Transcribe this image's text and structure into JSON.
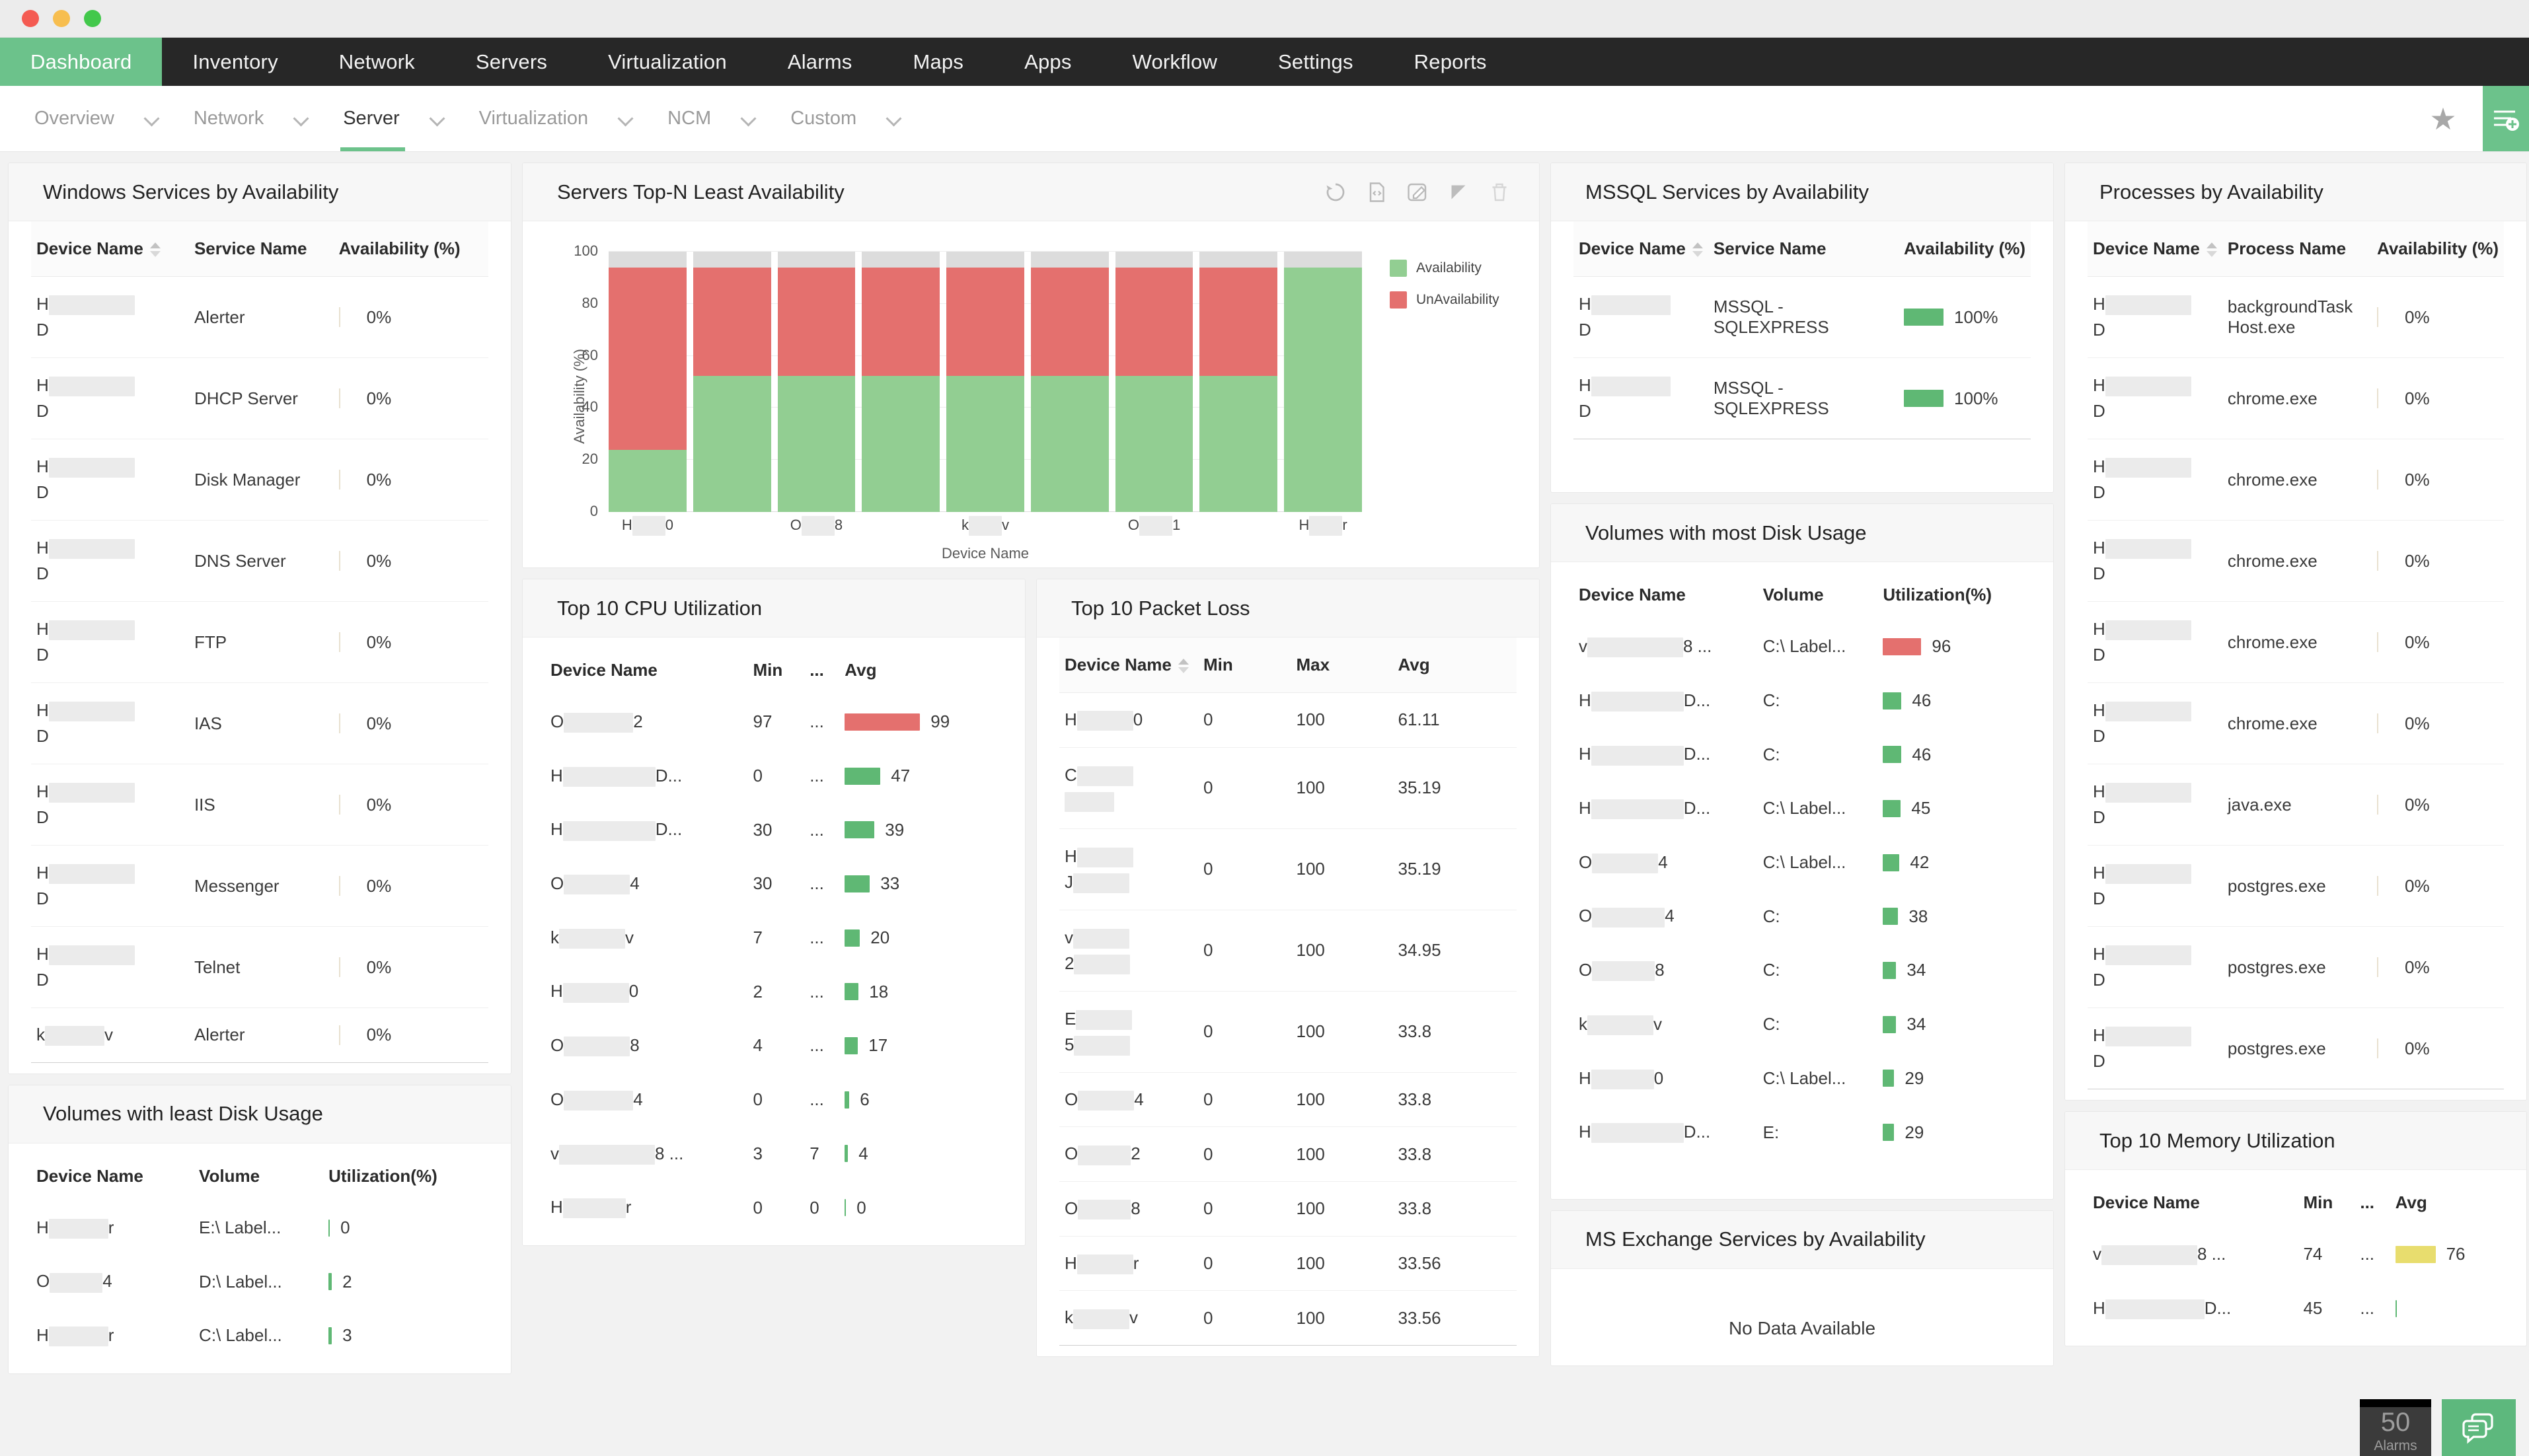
{
  "window": {
    "controls": [
      "close",
      "minimize",
      "maximize"
    ]
  },
  "main_nav": {
    "items": [
      {
        "label": "Dashboard",
        "active": true
      },
      {
        "label": "Inventory",
        "active": false
      },
      {
        "label": "Network",
        "active": false
      },
      {
        "label": "Servers",
        "active": false
      },
      {
        "label": "Virtualization",
        "active": false
      },
      {
        "label": "Alarms",
        "active": false
      },
      {
        "label": "Maps",
        "active": false
      },
      {
        "label": "Apps",
        "active": false
      },
      {
        "label": "Workflow",
        "active": false
      },
      {
        "label": "Settings",
        "active": false
      },
      {
        "label": "Reports",
        "active": false
      }
    ]
  },
  "sub_nav": {
    "items": [
      {
        "label": "Overview",
        "active": false
      },
      {
        "label": "Network",
        "active": false
      },
      {
        "label": "Server",
        "active": true
      },
      {
        "label": "Virtualization",
        "active": false
      },
      {
        "label": "NCM",
        "active": false
      },
      {
        "label": "Custom",
        "active": false
      }
    ],
    "favorite_icon": "star-icon",
    "add_widget_icon": "add-widget-icon"
  },
  "cards": {
    "windows_services": {
      "title": "Windows Services by Availability",
      "columns": [
        "Device Name",
        "Service Name",
        "Availability (%)"
      ],
      "rows": [
        {
          "device_prefix": "H",
          "device_suffix": "D",
          "redact_w": 130,
          "service": "Alerter",
          "availability": "0%"
        },
        {
          "device_prefix": "H",
          "device_suffix": "D",
          "redact_w": 130,
          "service": "DHCP Server",
          "availability": "0%"
        },
        {
          "device_prefix": "H",
          "device_suffix": "D",
          "redact_w": 130,
          "service": "Disk Manager",
          "availability": "0%"
        },
        {
          "device_prefix": "H",
          "device_suffix": "D",
          "redact_w": 130,
          "service": "DNS Server",
          "availability": "0%"
        },
        {
          "device_prefix": "H",
          "device_suffix": "D",
          "redact_w": 130,
          "service": "FTP",
          "availability": "0%"
        },
        {
          "device_prefix": "H",
          "device_suffix": "D",
          "redact_w": 130,
          "service": "IAS",
          "availability": "0%"
        },
        {
          "device_prefix": "H",
          "device_suffix": "D",
          "redact_w": 130,
          "service": "IIS",
          "availability": "0%"
        },
        {
          "device_prefix": "H",
          "device_suffix": "D",
          "redact_w": 130,
          "service": "Messenger",
          "availability": "0%"
        },
        {
          "device_prefix": "H",
          "device_suffix": "D",
          "redact_w": 130,
          "service": "Telnet",
          "availability": "0%"
        },
        {
          "device_prefix": "k",
          "device_suffix": "v",
          "redact_w": 90,
          "inline": true,
          "service": "Alerter",
          "availability": "0%"
        }
      ]
    },
    "volumes_least": {
      "title": "Volumes with least Disk Usage",
      "columns": [
        "Device Name",
        "Volume",
        "Utilization(%)"
      ],
      "rows": [
        {
          "device_prefix": "H",
          "device_suffix": "r",
          "redact_w": 90,
          "volume": "E:\\ Label...",
          "value": "0",
          "bar_pct": 0,
          "bar_color": "green"
        },
        {
          "device_prefix": "O",
          "device_suffix": "4",
          "redact_w": 80,
          "volume": "D:\\ Label...",
          "value": "2",
          "bar_pct": 2,
          "bar_color": "green"
        },
        {
          "device_prefix": "H",
          "device_suffix": "r",
          "redact_w": 90,
          "volume": "C:\\ Label...",
          "value": "3",
          "bar_pct": 3,
          "bar_color": "green"
        }
      ]
    },
    "servers_topn": {
      "title": "Servers Top-N Least Availability",
      "tools": [
        "refresh-icon",
        "export-code-icon",
        "edit-icon",
        "resize-icon",
        "delete-icon"
      ]
    },
    "cpu_util": {
      "title": "Top 10 CPU Utilization",
      "columns": [
        "Device Name",
        "Min",
        "...",
        "Avg"
      ],
      "rows": [
        {
          "device_prefix": "O",
          "device_suffix": "2",
          "redact_w": 105,
          "min": "97",
          "mid": "...",
          "avg": "99",
          "bar_pct": 99,
          "bar_color": "red"
        },
        {
          "device_prefix": "H",
          "device_suffix": "D...",
          "redact_w": 140,
          "min": "0",
          "mid": "...",
          "avg": "47",
          "bar_pct": 47,
          "bar_color": "green"
        },
        {
          "device_prefix": "H",
          "device_suffix": "D...",
          "redact_w": 140,
          "min": "30",
          "mid": "...",
          "avg": "39",
          "bar_pct": 39,
          "bar_color": "green"
        },
        {
          "device_prefix": "O",
          "device_suffix": "4",
          "redact_w": 100,
          "min": "30",
          "mid": "...",
          "avg": "33",
          "bar_pct": 33,
          "bar_color": "green"
        },
        {
          "device_prefix": "k",
          "device_suffix": "v",
          "redact_w": 100,
          "min": "7",
          "mid": "...",
          "avg": "20",
          "bar_pct": 20,
          "bar_color": "green"
        },
        {
          "device_prefix": "H",
          "device_suffix": "0",
          "redact_w": 100,
          "min": "2",
          "mid": "...",
          "avg": "18",
          "bar_pct": 18,
          "bar_color": "green"
        },
        {
          "device_prefix": "O",
          "device_suffix": "8",
          "redact_w": 100,
          "min": "4",
          "mid": "...",
          "avg": "17",
          "bar_pct": 17,
          "bar_color": "green"
        },
        {
          "device_prefix": "O",
          "device_suffix": "4",
          "redact_w": 105,
          "min": "0",
          "mid": "...",
          "avg": "6",
          "bar_pct": 6,
          "bar_color": "green"
        },
        {
          "device_prefix": "v",
          "device_suffix": "8 ...",
          "redact_w": 145,
          "min": "3",
          "mid": "7",
          "avg": "4",
          "bar_pct": 4,
          "bar_color": "green"
        },
        {
          "device_prefix": "H",
          "device_suffix": "r",
          "redact_w": 95,
          "min": "0",
          "mid": "0",
          "avg": "0",
          "bar_pct": 0,
          "bar_color": "green"
        }
      ]
    },
    "packet_loss": {
      "title": "Top 10 Packet Loss",
      "columns": [
        "Device Name",
        "Min",
        "Max",
        "Avg"
      ],
      "rows": [
        {
          "device_prefix": "H",
          "device_suffix": "0",
          "redact_w": 85,
          "inline": true,
          "min": "0",
          "max": "100",
          "avg": "61.11"
        },
        {
          "device_prefix": "C",
          "device_suffix": "",
          "redact_w": 85,
          "inline": false,
          "second_redact_w": 75,
          "min": "0",
          "max": "100",
          "avg": "35.19"
        },
        {
          "device_prefix": "H",
          "device_suffix": "J",
          "redact_w": 85,
          "inline": false,
          "second_redact_w": 85,
          "min": "0",
          "max": "100",
          "avg": "35.19"
        },
        {
          "device_prefix": "v",
          "device_suffix": "2",
          "redact_w": 85,
          "inline": false,
          "second_redact_w": 85,
          "min": "0",
          "max": "100",
          "avg": "34.95"
        },
        {
          "device_prefix": "E",
          "device_suffix": "5",
          "redact_w": 85,
          "inline": false,
          "second_redact_w": 85,
          "min": "0",
          "max": "100",
          "avg": "33.8"
        },
        {
          "device_prefix": "O",
          "device_suffix": "4",
          "redact_w": 85,
          "inline": true,
          "min": "0",
          "max": "100",
          "avg": "33.8"
        },
        {
          "device_prefix": "O",
          "device_suffix": "2",
          "redact_w": 80,
          "inline": true,
          "min": "0",
          "max": "100",
          "avg": "33.8"
        },
        {
          "device_prefix": "O",
          "device_suffix": "8",
          "redact_w": 80,
          "inline": true,
          "min": "0",
          "max": "100",
          "avg": "33.8"
        },
        {
          "device_prefix": "H",
          "device_suffix": "r",
          "redact_w": 85,
          "inline": true,
          "min": "0",
          "max": "100",
          "avg": "33.56"
        },
        {
          "device_prefix": "k",
          "device_suffix": "v",
          "redact_w": 85,
          "inline": true,
          "min": "0",
          "max": "100",
          "avg": "33.56"
        }
      ]
    },
    "mssql_services": {
      "title": "MSSQL Services by Availability",
      "columns": [
        "Device Name",
        "Service Name",
        "Availability (%)"
      ],
      "rows": [
        {
          "device_prefix": "H",
          "device_suffix": "D",
          "redact_w": 120,
          "service": "MSSQL - SQLEXPRESS",
          "value": "100%",
          "bar_pct": 100,
          "bar_color": "green"
        },
        {
          "device_prefix": "H",
          "device_suffix": "D",
          "redact_w": 120,
          "service": "MSSQL - SQLEXPRESS",
          "value": "100%",
          "bar_pct": 100,
          "bar_color": "green"
        }
      ]
    },
    "volumes_most": {
      "title": "Volumes with most Disk Usage",
      "columns": [
        "Device Name",
        "Volume",
        "Utilization(%)"
      ],
      "rows": [
        {
          "device_prefix": "v",
          "device_suffix": "8 ...",
          "redact_w": 145,
          "volume": "C:\\ Label...",
          "value": "96",
          "bar_pct": 96,
          "bar_color": "red"
        },
        {
          "device_prefix": "H",
          "device_suffix": "D...",
          "redact_w": 140,
          "volume": "C:",
          "value": "46",
          "bar_pct": 46,
          "bar_color": "green"
        },
        {
          "device_prefix": "H",
          "device_suffix": "D...",
          "redact_w": 140,
          "volume": "C:",
          "value": "46",
          "bar_pct": 46,
          "bar_color": "green"
        },
        {
          "device_prefix": "H",
          "device_suffix": "D...",
          "redact_w": 140,
          "volume": "C:\\ Label...",
          "value": "45",
          "bar_pct": 45,
          "bar_color": "green"
        },
        {
          "device_prefix": "O",
          "device_suffix": "4",
          "redact_w": 100,
          "volume": "C:\\ Label...",
          "value": "42",
          "bar_pct": 42,
          "bar_color": "green"
        },
        {
          "device_prefix": "O",
          "device_suffix": "4",
          "redact_w": 110,
          "volume": "C:",
          "value": "38",
          "bar_pct": 38,
          "bar_color": "green"
        },
        {
          "device_prefix": "O",
          "device_suffix": "8",
          "redact_w": 95,
          "volume": "C:",
          "value": "34",
          "bar_pct": 34,
          "bar_color": "green"
        },
        {
          "device_prefix": "k",
          "device_suffix": "v",
          "redact_w": 100,
          "volume": "C:",
          "value": "34",
          "bar_pct": 34,
          "bar_color": "green"
        },
        {
          "device_prefix": "H",
          "device_suffix": "0",
          "redact_w": 95,
          "volume": "C:\\ Label...",
          "value": "29",
          "bar_pct": 29,
          "bar_color": "green"
        },
        {
          "device_prefix": "H",
          "device_suffix": "D...",
          "redact_w": 140,
          "volume": "E:",
          "value": "29",
          "bar_pct": 29,
          "bar_color": "green"
        }
      ]
    },
    "ms_exchange": {
      "title": "MS Exchange Services by Availability",
      "empty_message": "No Data Available"
    },
    "processes": {
      "title": "Processes by Availability",
      "columns": [
        "Device Name",
        "Process Name",
        "Availability (%)"
      ],
      "rows": [
        {
          "device_prefix": "H",
          "device_suffix": "D",
          "redact_w": 130,
          "process": "backgroundTask Host.exe",
          "availability": "0%"
        },
        {
          "device_prefix": "H",
          "device_suffix": "D",
          "redact_w": 130,
          "process": "chrome.exe",
          "availability": "0%"
        },
        {
          "device_prefix": "H",
          "device_suffix": "D",
          "redact_w": 130,
          "process": "chrome.exe",
          "availability": "0%"
        },
        {
          "device_prefix": "H",
          "device_suffix": "D",
          "redact_w": 130,
          "process": "chrome.exe",
          "availability": "0%"
        },
        {
          "device_prefix": "H",
          "device_suffix": "D",
          "redact_w": 130,
          "process": "chrome.exe",
          "availability": "0%"
        },
        {
          "device_prefix": "H",
          "device_suffix": "D",
          "redact_w": 130,
          "process": "chrome.exe",
          "availability": "0%"
        },
        {
          "device_prefix": "H",
          "device_suffix": "D",
          "redact_w": 130,
          "process": "java.exe",
          "availability": "0%"
        },
        {
          "device_prefix": "H",
          "device_suffix": "D",
          "redact_w": 130,
          "process": "postgres.exe",
          "availability": "0%"
        },
        {
          "device_prefix": "H",
          "device_suffix": "D",
          "redact_w": 130,
          "process": "postgres.exe",
          "availability": "0%"
        },
        {
          "device_prefix": "H",
          "device_suffix": "D",
          "redact_w": 130,
          "process": "postgres.exe",
          "availability": "0%"
        }
      ]
    },
    "memory_util": {
      "title": "Top 10 Memory Utilization",
      "columns": [
        "Device Name",
        "Min",
        "...",
        "Avg"
      ],
      "rows": [
        {
          "device_prefix": "v",
          "device_suffix": "8 ...",
          "redact_w": 145,
          "min": "74",
          "mid": "...",
          "avg": "76",
          "bar_pct": 76,
          "bar_color": "yellow"
        },
        {
          "device_prefix": "H",
          "device_suffix": "D...",
          "redact_w": 150,
          "min": "45",
          "mid": "...",
          "avg": "",
          "bar_pct": 0,
          "bar_color": "green"
        }
      ]
    }
  },
  "floating": {
    "alarms_count": "50",
    "alarms_label": "Alarms",
    "chat_icon": "chat-icon"
  },
  "colors": {
    "brand_green": "#6cc28b",
    "nav_dark": "#272727",
    "bar_green": "#92ce92",
    "bar_red": "#e4706e",
    "bar_yellow": "#e8dd6e",
    "gray_segment": "#dcdcdc"
  },
  "chart_data": {
    "type": "bar",
    "title": "Servers Top-N Least Availability",
    "xlabel": "Device Name",
    "ylabel": "Availability (%)",
    "ylim": [
      0,
      100
    ],
    "yticks": [
      0,
      20,
      40,
      60,
      80,
      100
    ],
    "grid": true,
    "stacked": true,
    "legend_position": "right",
    "categories": [
      "H…0",
      "",
      "O…8",
      "",
      "k…v",
      "",
      "O…1",
      "",
      "H…r"
    ],
    "tick_labels": [
      "H          0",
      "O          8",
      "k        v",
      "O         1",
      "H       r"
    ],
    "series": [
      {
        "name": "Availability",
        "color": "#92ce92",
        "values": [
          25.5,
          55.5,
          55.5,
          55.5,
          55.5,
          55.5,
          55.5,
          55.5,
          100
        ]
      },
      {
        "name": "UnAvailability",
        "color": "#e4706e",
        "values": [
          74.5,
          44.5,
          44.5,
          44.5,
          44.5,
          44.5,
          44.5,
          44.5,
          0
        ]
      }
    ],
    "legend": [
      "Availability",
      "UnAvailability"
    ]
  }
}
